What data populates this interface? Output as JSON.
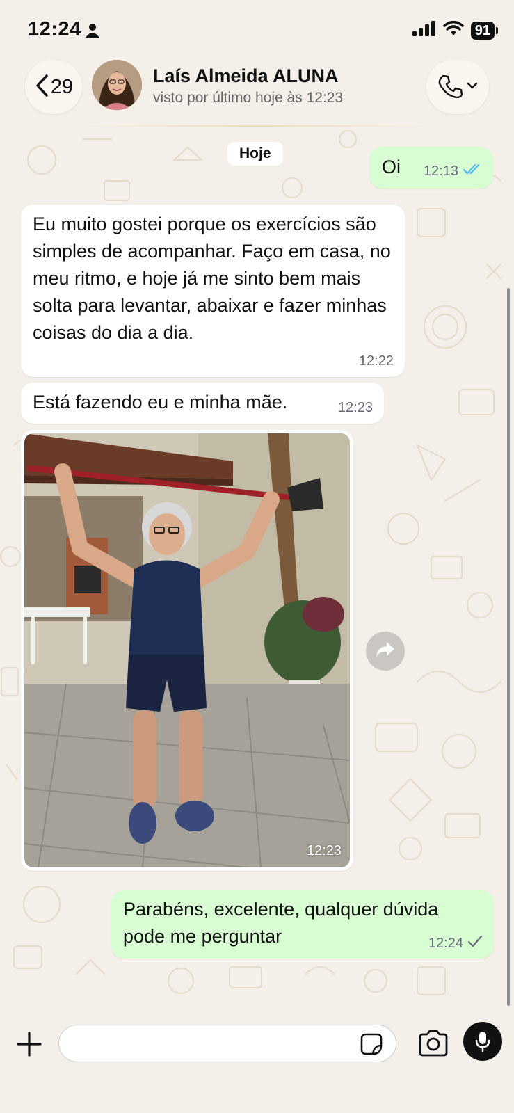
{
  "status_bar": {
    "time": "12:24",
    "battery": "91",
    "icons": [
      "person-icon",
      "cellular-signal-icon",
      "wifi-icon",
      "battery-icon"
    ]
  },
  "header": {
    "back_count": "29",
    "contact_name": "Laís Almeida ALUNA",
    "contact_status": "visto por último hoje às 12:23",
    "icons": [
      "chevron-left-icon",
      "phone-icon",
      "chevron-down-icon"
    ]
  },
  "chat": {
    "date_separator": "Hoje",
    "messages": [
      {
        "direction": "outgoing",
        "text": "Oi",
        "time": "12:13",
        "status": "read"
      },
      {
        "direction": "incoming",
        "text": "Eu muito gostei porque os exercícios são simples de acompanhar. Faço em casa, no meu ritmo, e hoje já me sinto bem mais solta para levantar, abaixar e fazer minhas coisas do dia a dia.",
        "time": "12:22"
      },
      {
        "direction": "incoming",
        "text": "Está fazendo eu e minha mãe.",
        "time": "12:23"
      },
      {
        "direction": "incoming",
        "type": "image",
        "time": "12:23"
      },
      {
        "direction": "outgoing",
        "text": "Parabéns, excelente, qualquer dúvida pode me perguntar",
        "time": "12:24",
        "status": "sent"
      }
    ]
  },
  "input_bar": {
    "placeholder": "",
    "icons": [
      "plus-icon",
      "sticker-icon",
      "camera-icon",
      "microphone-icon"
    ]
  },
  "colors": {
    "outgoing_bubble": "#d9fdd3",
    "incoming_bubble": "#ffffff",
    "background": "#f4efe8",
    "read_ticks": "#53bdeb"
  }
}
